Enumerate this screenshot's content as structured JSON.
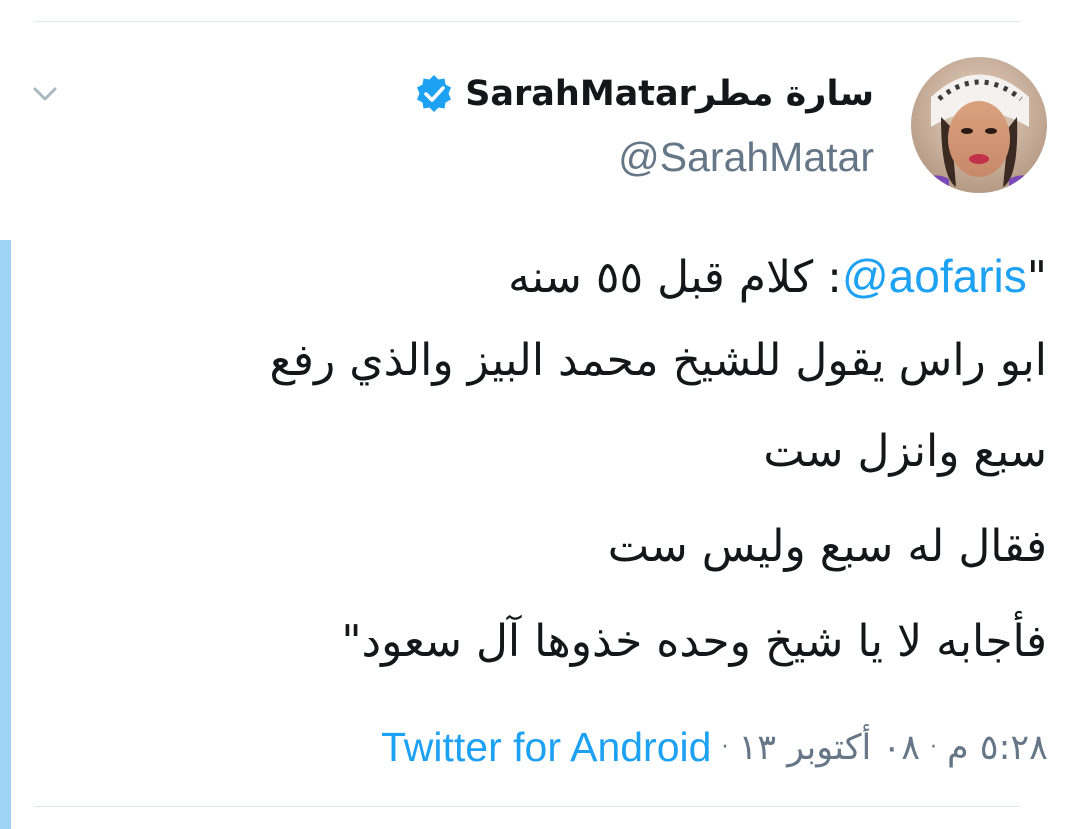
{
  "tweet": {
    "display_name": "سارة مطرSarahMatar",
    "handle": "@SarahMatar",
    "quote_open": "\"",
    "mention": "@aofaris",
    "line1_text": ": كلام قبل ٥٥ سنه",
    "line2_text": "ابو راس يقول للشيخ محمد البيز والذي رفع",
    "line3_text": "سبع وانزل ست",
    "line4_text": "فقال له سبع وليس ست",
    "line5_text": "فأجابه لا يا شيخ وحده خذوها آل سعود\"",
    "time": "٥:٢٨ م",
    "date": "٠٨ أكتوبر ١٣",
    "separator": "·",
    "source": "Twitter for Android"
  },
  "icons": {
    "verified": "verified-badge-icon",
    "caret": "chevron-down-icon"
  },
  "colors": {
    "accent": "#1da1f2",
    "text": "#14171a",
    "muted": "#657786",
    "thread_line": "#9fd4f6"
  }
}
